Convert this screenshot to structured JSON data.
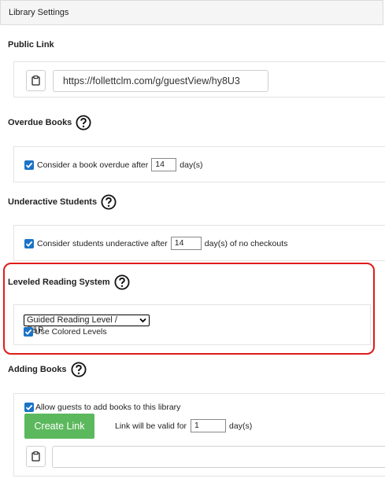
{
  "panel_title": "Library Settings",
  "public_link": {
    "title": "Public Link",
    "url": "https://follettclm.com/g/guestView/hy8U3"
  },
  "overdue": {
    "title": "Overdue Books",
    "label_before": "Consider a book overdue after",
    "value": "14",
    "label_after": "day(s)",
    "checked": true
  },
  "underactive": {
    "title": "Underactive Students",
    "label_before": "Consider students underactive after",
    "value": "14",
    "label_after": "day(s) of no checkouts",
    "checked": true
  },
  "leveled": {
    "title": "Leveled Reading System",
    "selected_option": "Guided Reading Level / F&P",
    "colored_label": "Use Colored Levels",
    "colored_checked": true
  },
  "adding": {
    "title": "Adding Books",
    "allow_label": "Allow guests to add books to this library",
    "allow_checked": true,
    "create_label": "Create Link",
    "valid_label": "Link will be valid for",
    "valid_value": "1",
    "valid_unit": "day(s)",
    "link_value": ""
  },
  "icons": {
    "help": "question-circle-icon",
    "clipboard": "clipboard-icon",
    "dropdown": "chevron-down-icon",
    "checkbox": "check-icon"
  },
  "colors": {
    "accent": "#1a73c6",
    "highlight": "#e01b1b",
    "create_button": "#5cb85c"
  }
}
